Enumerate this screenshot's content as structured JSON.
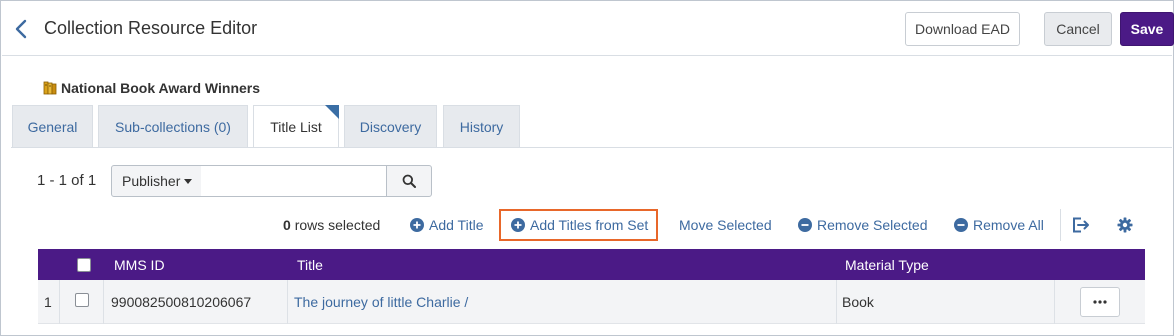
{
  "header": {
    "title": "Collection Resource Editor",
    "download_label": "Download EAD",
    "cancel_label": "Cancel",
    "save_label": "Save"
  },
  "collection": {
    "name": "National Book Award Winners"
  },
  "tabs": [
    {
      "label": "General",
      "active": false
    },
    {
      "label": "Sub-collections (0)",
      "active": false
    },
    {
      "label": "Title List",
      "active": true
    },
    {
      "label": "Discovery",
      "active": false
    },
    {
      "label": "History",
      "active": false
    }
  ],
  "pagination": {
    "text": "1 - 1 of 1"
  },
  "search": {
    "field_label": "Publisher",
    "value": "",
    "placeholder": ""
  },
  "selection": {
    "count": "0",
    "suffix": "rows selected"
  },
  "actions": {
    "add_title": "Add Title",
    "add_titles_from_set": "Add Titles from Set",
    "move_selected": "Move Selected",
    "remove_selected": "Remove Selected",
    "remove_all": "Remove All"
  },
  "table": {
    "columns": [
      "MMS ID",
      "Title",
      "Material Type"
    ],
    "rows": [
      {
        "index": "1",
        "mms_id": "990082500810206067",
        "title": "The journey of little Charlie /",
        "material_type": "Book"
      }
    ]
  },
  "colors": {
    "brand": "#4b1a86",
    "link": "#3d6aa0",
    "highlight": "#e8672a"
  }
}
